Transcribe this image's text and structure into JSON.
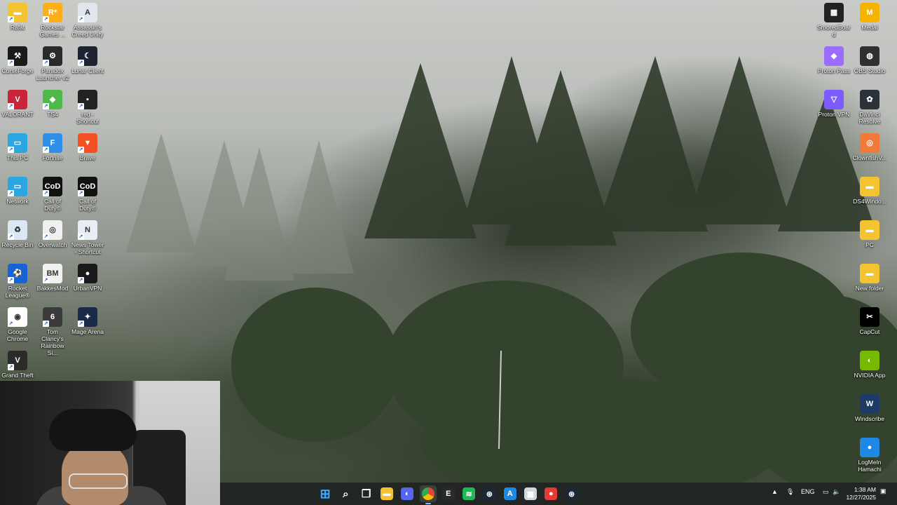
{
  "desktop": {
    "left_icons": [
      {
        "label": "Rafat",
        "icon": "folder-icon",
        "color": "#f4c430"
      },
      {
        "label": "Rockstar Games ...",
        "icon": "rockstar-icon",
        "color": "#fcaf17"
      },
      {
        "label": "Assassin's Creed Unity",
        "icon": "assassins-creed-icon",
        "color": "#dfe6ee"
      },
      {
        "label": "CurseForge",
        "icon": "curseforge-icon",
        "color": "#1a1a1a"
      },
      {
        "label": "Paradox Launcher v2",
        "icon": "paradox-icon",
        "color": "#2a2a2a"
      },
      {
        "label": "Lunar Client",
        "icon": "lunar-client-icon",
        "color": "#1d2430"
      },
      {
        "label": "VALORANT",
        "icon": "valorant-icon",
        "color": "#c8243c"
      },
      {
        "label": "TS4",
        "icon": "sims4-icon",
        "color": "#4fb848"
      },
      {
        "label": "red - Shortcut",
        "icon": "red-shortcut-icon",
        "color": "#222222"
      },
      {
        "label": "This PC",
        "icon": "monitor-icon",
        "color": "#2aa7e0"
      },
      {
        "label": "Fortnite",
        "icon": "fortnite-icon",
        "color": "#2f8fe8"
      },
      {
        "label": "Brave",
        "icon": "brave-icon",
        "color": "#f25022"
      },
      {
        "label": "Network",
        "icon": "network-icon",
        "color": "#2aa7e0"
      },
      {
        "label": "Call of Duty®",
        "icon": "call-of-duty-icon",
        "color": "#111111"
      },
      {
        "label": "Call of Duty®",
        "icon": "call-of-duty-icon",
        "color": "#111111"
      },
      {
        "label": "Recycle Bin",
        "icon": "recycle-bin-icon",
        "color": "#dbe8f3"
      },
      {
        "label": "Overwatch",
        "icon": "overwatch-icon",
        "color": "#f0f0f0"
      },
      {
        "label": "News Tower - Shortcut",
        "icon": "news-tower-icon",
        "color": "#e9eef5"
      },
      {
        "label": "Rocket League®",
        "icon": "rocket-league-icon",
        "color": "#1762d6"
      },
      {
        "label": "BakkesMod",
        "icon": "bakkesmod-icon",
        "color": "#f1f1f1"
      },
      {
        "label": "UrbanVPN",
        "icon": "urbanvpn-icon",
        "color": "#1a1a1a"
      },
      {
        "label": "Google Chrome",
        "icon": "chrome-icon",
        "color": "#ffffff"
      },
      {
        "label": "Tom Clancy's Rainbow Si...",
        "icon": "rainbow-six-icon",
        "color": "#3a3a3a"
      },
      {
        "label": "Mage Arena",
        "icon": "mage-arena-icon",
        "color": "#1c2a4a"
      },
      {
        "label": "Grand Theft",
        "icon": "gta-v-icon",
        "color": "#2b2b2b"
      }
    ],
    "right_icons": [
      {
        "label": "SmoredBoard",
        "icon": "smoredboard-icon",
        "color": "#222222"
      },
      {
        "label": "Medal",
        "icon": "medal-icon",
        "color": "#f5b400"
      },
      {
        "label": "Proton Pass",
        "icon": "proton-pass-icon",
        "color": "#9b6cff"
      },
      {
        "label": "OBS Studio",
        "icon": "obs-icon",
        "color": "#302e31"
      },
      {
        "label": "Proton VPN",
        "icon": "proton-vpn-icon",
        "color": "#7c5cff"
      },
      {
        "label": "DaVinci Resolve",
        "icon": "davinci-icon",
        "color": "#2c3338"
      },
      {
        "label": "ClownfishV...",
        "icon": "clownfish-icon",
        "color": "#f07a3a"
      },
      {
        "label": "DS4Windo...",
        "icon": "folder-icon",
        "color": "#f4c430"
      },
      {
        "label": "PC",
        "icon": "pc-folder-icon",
        "color": "#f4c430"
      },
      {
        "label": "New folder",
        "icon": "folder-icon",
        "color": "#f4c430"
      },
      {
        "label": "CapCut",
        "icon": "capcut-icon",
        "color": "#000000"
      },
      {
        "label": "NVIDIA App",
        "icon": "nvidia-icon",
        "color": "#76b900"
      },
      {
        "label": "Windscribe",
        "icon": "windscribe-icon",
        "color": "#1d3b66"
      },
      {
        "label": "LogMeIn Hamachi",
        "icon": "hamachi-icon",
        "color": "#1e88e5"
      }
    ]
  },
  "taskbar": {
    "apps": [
      {
        "name": "start-button",
        "icon": "windows-logo-icon",
        "color": "#3ea6ff"
      },
      {
        "name": "search-button",
        "icon": "search-icon",
        "color": "#ffffff"
      },
      {
        "name": "task-view-button",
        "icon": "task-view-icon",
        "color": "#ffffff"
      },
      {
        "name": "file-explorer",
        "icon": "folder-icon",
        "color": "#f4c430"
      },
      {
        "name": "discord",
        "icon": "discord-icon",
        "color": "#5865f2"
      },
      {
        "name": "chrome",
        "icon": "chrome-icon",
        "color": "#ffffff",
        "active": true
      },
      {
        "name": "epic-games",
        "icon": "epic-games-icon",
        "color": "#2a2a2a"
      },
      {
        "name": "spotify",
        "icon": "spotify-icon",
        "color": "#1db954"
      },
      {
        "name": "steam",
        "icon": "steam-icon",
        "color": "#1b2838"
      },
      {
        "name": "app-store",
        "icon": "app-store-icon",
        "color": "#1e88e5"
      },
      {
        "name": "gaming-app",
        "icon": "gaming-icon",
        "color": "#cfd8dc"
      },
      {
        "name": "record-app",
        "icon": "record-icon",
        "color": "#e53935"
      },
      {
        "name": "steam-2",
        "icon": "steam-icon",
        "color": "#1b2838"
      }
    ],
    "tray": {
      "language": "ENG",
      "time": "1:38 AM",
      "date": "12/27/2025"
    }
  }
}
